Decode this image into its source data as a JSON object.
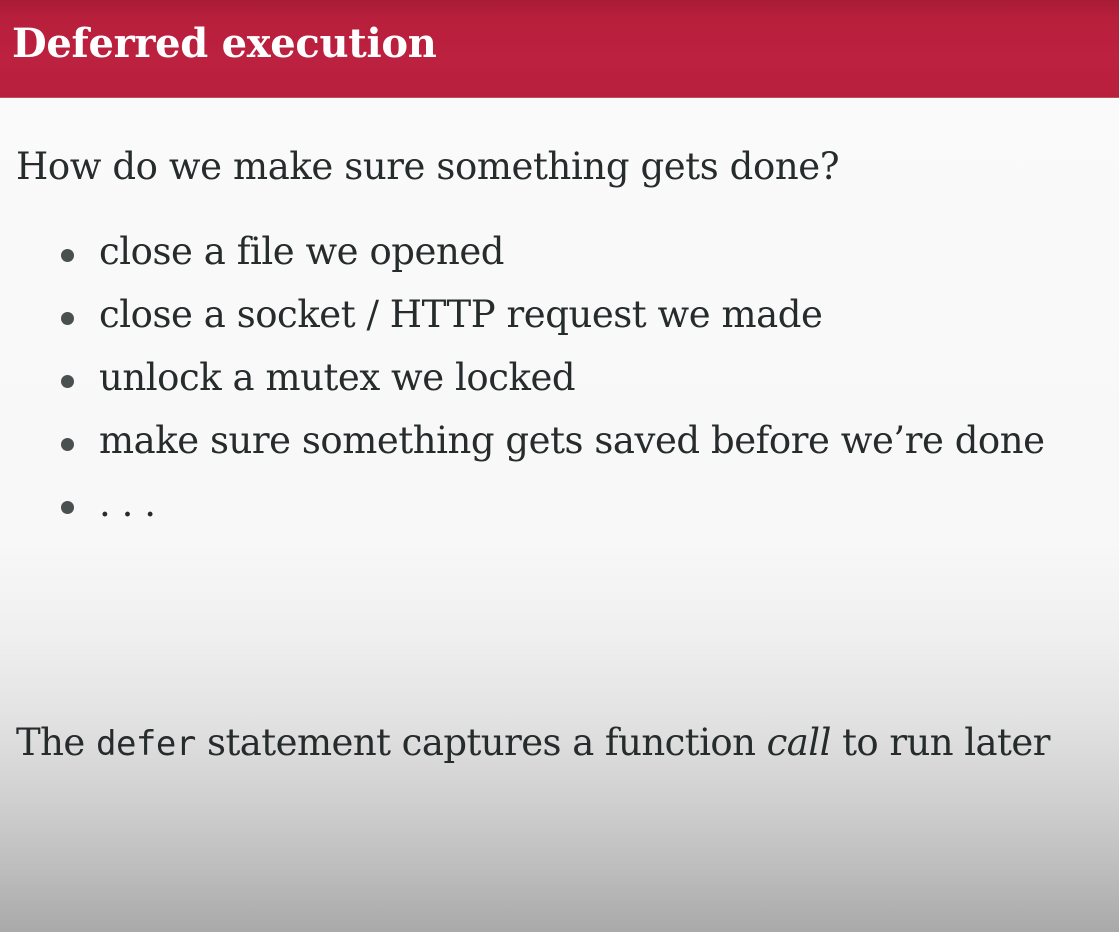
{
  "slide": {
    "title": "Deferred execution",
    "question": "How do we make sure something gets done?",
    "bullets": [
      "close a file we opened",
      "close a socket / HTTP request we made",
      "unlock a mutex we locked",
      "make sure something gets saved before we’re done",
      ". . ."
    ],
    "statement": {
      "part1": "The ",
      "code": "defer",
      "part2": " statement captures a function ",
      "emphasis": "call",
      "part3": " to run later"
    }
  },
  "colors": {
    "title_bar": "#bc2140",
    "title_text": "#ffffff",
    "body_text": "#262b2b"
  }
}
